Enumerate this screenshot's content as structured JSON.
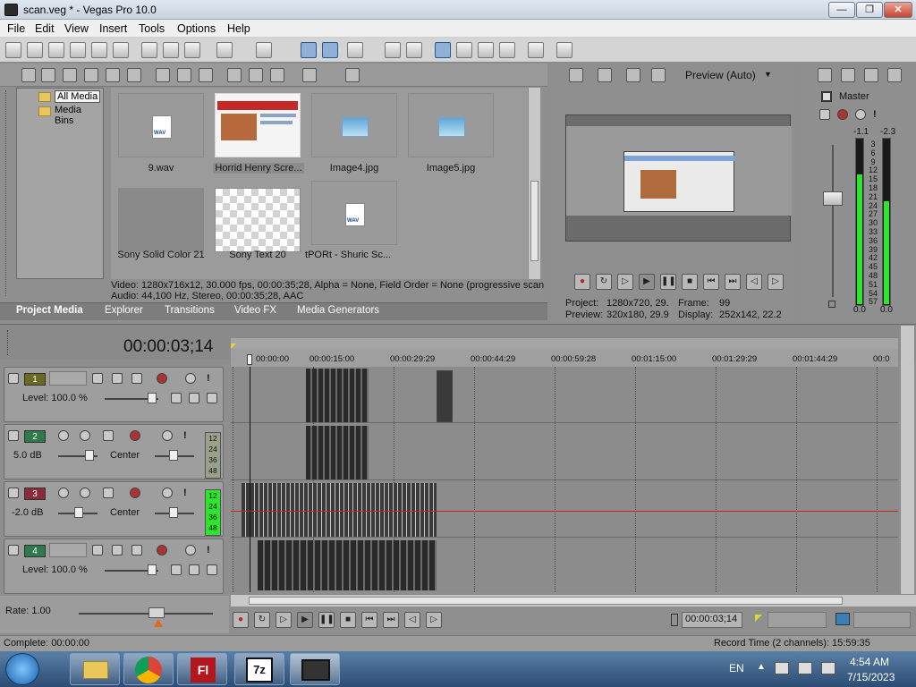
{
  "window": {
    "title": "scan.veg * - Vegas Pro 10.0",
    "buttons": [
      "—",
      "❐",
      "✕"
    ]
  },
  "menu": [
    "File",
    "Edit",
    "View",
    "Insert",
    "Tools",
    "Options",
    "Help"
  ],
  "tree": [
    "All Media",
    "Media Bins"
  ],
  "media": [
    {
      "name": "9.wav",
      "kind": "wav"
    },
    {
      "name": "Horrid Henry Scre...",
      "kind": "screenshot",
      "selected": true
    },
    {
      "name": "Image4.jpg",
      "kind": "image"
    },
    {
      "name": "Image5.jpg",
      "kind": "image"
    },
    {
      "name": "Sony Solid Color 21",
      "kind": "solid"
    },
    {
      "name": "Sony Text 20",
      "kind": "checker"
    },
    {
      "name": "tPORt - Shuric Sc...",
      "kind": "wav"
    }
  ],
  "media_info": {
    "video": "Video: 1280x716x12, 30.000 fps, 00:00:35;28, Alpha = None, Field Order = None (progressive scan",
    "audio": "Audio: 44,100 Hz, Stereo, 00:00:35;28, AAC"
  },
  "tabs": [
    "Project Media",
    "Explorer",
    "Transitions",
    "Video FX",
    "Media Generators"
  ],
  "preview": {
    "mode": "Preview (Auto)",
    "project_label": "Project:",
    "project_value": "1280x720, 29.",
    "frame_label": "Frame:",
    "frame_value": "99",
    "preview_label": "Preview:",
    "preview_value": "320x180, 29.9",
    "display_label": "Display:",
    "display_value": "252x142, 22.2"
  },
  "master": {
    "label": "Master",
    "peak_left": "-1.1",
    "peak_right": "-2.3",
    "scale": [
      "3",
      "6",
      "9",
      "12",
      "15",
      "18",
      "21",
      "24",
      "27",
      "30",
      "33",
      "36",
      "39",
      "42",
      "45",
      "48",
      "51",
      "54",
      "57"
    ],
    "bottom_left": "0.0",
    "bottom_right": "0.0",
    "level_left": 0.78,
    "level_right": 0.62
  },
  "timecode": "00:00:03;14",
  "ruler": [
    "00:00:00",
    "00:00:15:00",
    "00:00:29:29",
    "00:00:44:29",
    "00:00:59:28",
    "00:01:15:00",
    "00:01:29:29",
    "00:01:44:29",
    "00:0"
  ],
  "tracks": [
    {
      "num": "1",
      "type": "video",
      "color": "#6a6a23",
      "label": "Level: 100.0 %"
    },
    {
      "num": "2",
      "type": "audio",
      "color": "#2f7a4a",
      "label": "5.0 dB",
      "pan": "Center",
      "meter": [
        "12",
        "24",
        "36",
        "48"
      ]
    },
    {
      "num": "3",
      "type": "audio",
      "color": "#8a2a3a",
      "label": "-2.0 dB",
      "pan": "Center",
      "meter": [
        "12",
        "24",
        "36",
        "48"
      ]
    },
    {
      "num": "4",
      "type": "video",
      "color": "#2f7a4a",
      "label": "Level: 100.0 %"
    }
  ],
  "rate": {
    "label": "Rate: 1.00"
  },
  "transport_time": "00:00:03;14",
  "status": {
    "left": "Complete: 00:00:00",
    "right": "Record Time (2 channels): 15:59:35"
  },
  "taskbar": {
    "lang": "EN",
    "time": "4:54 AM",
    "date": "7/15/2023"
  }
}
